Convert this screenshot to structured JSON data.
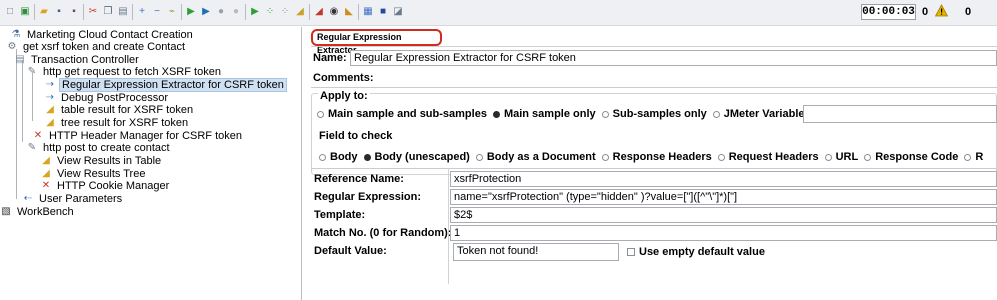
{
  "toolbar": {
    "buttons": [
      {
        "name": "new-icon",
        "glyph": "□",
        "color": "#6b7b8c"
      },
      {
        "name": "templates-icon",
        "glyph": "▣",
        "color": "#2f8f3e"
      },
      {
        "name": "open-icon",
        "glyph": "▰",
        "color": "#d9a521"
      },
      {
        "name": "save-icon",
        "glyph": "▪",
        "color": "#3a5f9a"
      },
      {
        "name": "save-as-icon",
        "glyph": "▪",
        "color": "#7a3a8a"
      },
      {
        "name": "cut-icon",
        "glyph": "✂",
        "color": "#c0392b"
      },
      {
        "name": "copy-icon",
        "glyph": "❐",
        "color": "#5a6b7c"
      },
      {
        "name": "paste-icon",
        "glyph": "▤",
        "color": "#6b7b8c"
      },
      {
        "name": "expand-icon",
        "glyph": "+",
        "color": "#3d72c4"
      },
      {
        "name": "collapse-icon",
        "glyph": "−",
        "color": "#3d72c4"
      },
      {
        "name": "toggle-icon",
        "glyph": "⌁",
        "color": "#7aa840"
      },
      {
        "name": "start-icon",
        "glyph": "▶",
        "color": "#2e9e3e"
      },
      {
        "name": "start-no-pauses-icon",
        "glyph": "▶",
        "color": "#1f6fb5"
      },
      {
        "name": "stop-icon",
        "glyph": "●",
        "color": "#9aa0a6"
      },
      {
        "name": "shutdown-icon",
        "glyph": "●",
        "color": "#b5babf"
      },
      {
        "name": "remote-start-icon",
        "glyph": "▶",
        "color": "#2e9e3e"
      },
      {
        "name": "remote-start-all-icon",
        "glyph": "⁘",
        "color": "#2e9e3e"
      },
      {
        "name": "remote-stop-icon",
        "glyph": "⁘",
        "color": "#8a9099"
      },
      {
        "name": "clear-icon",
        "glyph": "◢",
        "color": "#c7a224"
      },
      {
        "name": "clear-all-icon",
        "glyph": "◢",
        "color": "#c0392b"
      },
      {
        "name": "search-icon",
        "glyph": "◉",
        "color": "#333333"
      },
      {
        "name": "reset-search-icon",
        "glyph": "◣",
        "color": "#d08a1e"
      },
      {
        "name": "function-helper-icon",
        "glyph": "▦",
        "color": "#3d72c4"
      },
      {
        "name": "help-icon",
        "glyph": "■",
        "color": "#1f4f9a"
      },
      {
        "name": "log-viewer-icon",
        "glyph": "◪",
        "color": "#6b7b8c"
      }
    ],
    "timer": "00:00:03",
    "error_count": "0",
    "thread_count": "0"
  },
  "tree": {
    "nodes": [
      {
        "label": "Marketing Cloud Contact Creation",
        "icon": "test-plan-icon",
        "glyph": "⚗",
        "color": "#4a6fa5"
      },
      {
        "label": "get xsrf token and create Contact",
        "icon": "thread-group-icon",
        "glyph": "⚙",
        "color": "#6b7b8c"
      },
      {
        "label": "Transaction Controller",
        "icon": "transaction-controller-icon",
        "glyph": "▤",
        "color": "#7a8a9a"
      },
      {
        "label": "http get request to fetch XSRF token",
        "icon": "http-sampler-icon",
        "glyph": "✎",
        "color": "#6b7b8c"
      },
      {
        "label": "Regular Expression Extractor for CSRF token",
        "icon": "post-processor-icon",
        "glyph": "⇢",
        "color": "#3d72c4"
      },
      {
        "label": "Debug PostProcessor",
        "icon": "post-processor-icon",
        "glyph": "⇢",
        "color": "#3d72c4"
      },
      {
        "label": "table result for XSRF token",
        "icon": "listener-icon",
        "glyph": "◢",
        "color": "#d9a521"
      },
      {
        "label": "tree result for XSRF token",
        "icon": "listener-icon",
        "glyph": "◢",
        "color": "#d9a521"
      },
      {
        "label": "HTTP Header Manager for CSRF token",
        "icon": "config-element-icon",
        "glyph": "✕",
        "color": "#c0392b"
      },
      {
        "label": "http post to create contact",
        "icon": "http-sampler-icon",
        "glyph": "✎",
        "color": "#6b7b8c"
      },
      {
        "label": "View Results in Table",
        "icon": "listener-icon",
        "glyph": "◢",
        "color": "#d9a521"
      },
      {
        "label": "View Results Tree",
        "icon": "listener-icon",
        "glyph": "◢",
        "color": "#d9a521"
      },
      {
        "label": "HTTP Cookie Manager",
        "icon": "config-element-icon",
        "glyph": "✕",
        "color": "#c0392b"
      },
      {
        "label": "User Parameters",
        "icon": "pre-processor-icon",
        "glyph": "⇠",
        "color": "#3d72c4"
      },
      {
        "label": "WorkBench",
        "icon": "workbench-icon",
        "glyph": "▧",
        "color": "#333333"
      }
    ]
  },
  "panel": {
    "title": "Regular Expression Extractor",
    "name_label": "Name:",
    "name_value": "Regular Expression Extractor for CSRF token",
    "comments_label": "Comments:",
    "apply_to_label": "Apply to:",
    "apply_options": [
      {
        "label": "Main sample and sub-samples",
        "selected": false
      },
      {
        "label": "Main sample only",
        "selected": true
      },
      {
        "label": "Sub-samples only",
        "selected": false
      },
      {
        "label": "JMeter Variable",
        "selected": false
      }
    ],
    "field_to_check_label": "Field to check",
    "field_options": [
      {
        "label": "Body",
        "selected": false
      },
      {
        "label": "Body (unescaped)",
        "selected": true
      },
      {
        "label": "Body as a Document",
        "selected": false
      },
      {
        "label": "Response Headers",
        "selected": false
      },
      {
        "label": "Request Headers",
        "selected": false
      },
      {
        "label": "URL",
        "selected": false
      },
      {
        "label": "Response Code",
        "selected": false
      },
      {
        "label": "R",
        "selected": false
      }
    ],
    "reference_name_label": "Reference Name:",
    "reference_name_value": "xsrfProtection",
    "regex_label": "Regular Expression:",
    "regex_value": "name=\"xsrfProtection\" (type=\"hidden\" )?value=[\"]([^\"\\\"]*)[\"]",
    "template_label": "Template:",
    "template_value": "$2$",
    "match_no_label": "Match No. (0 for Random):",
    "match_no_value": "1",
    "default_value_label": "Default Value:",
    "default_value_value": "Token not found!",
    "use_empty_default_label": "Use empty default value"
  },
  "colors": {
    "accent_highlight": "#d22c1f",
    "selection": "#cfe0f3",
    "warning": "#e5b400"
  }
}
